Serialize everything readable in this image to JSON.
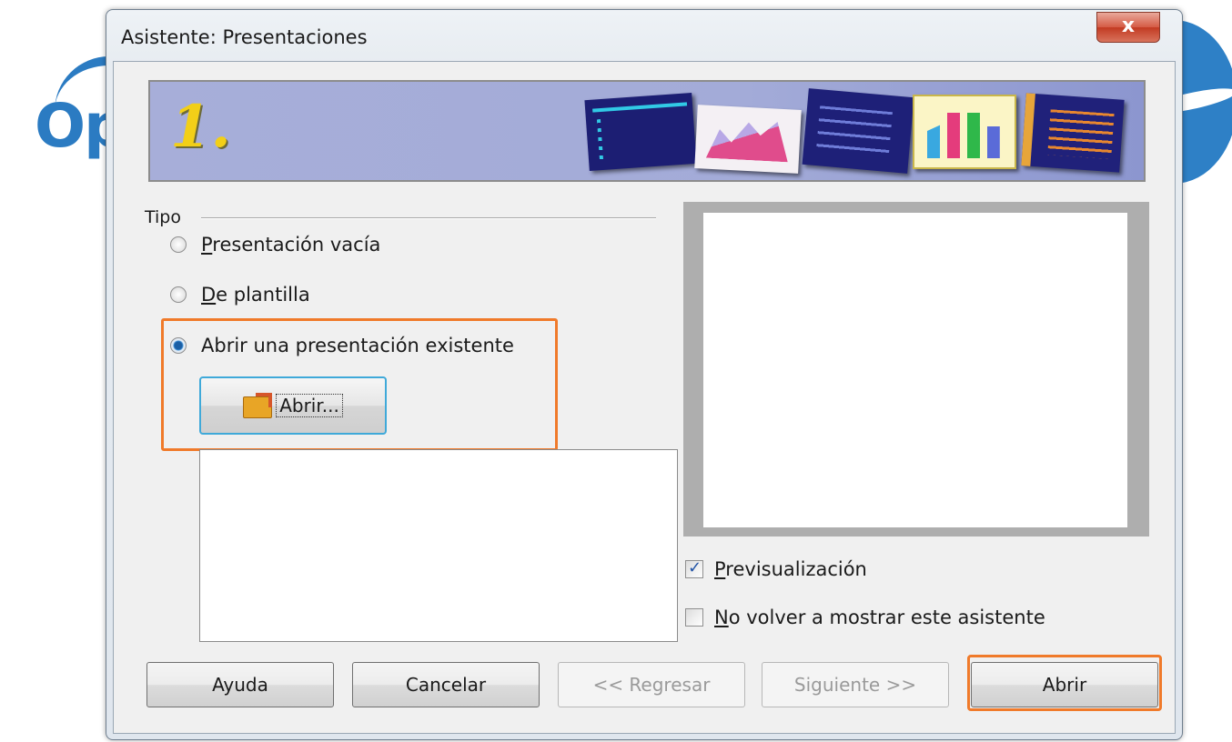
{
  "background": {
    "logo_text": "Op"
  },
  "window": {
    "title": "Asistente: Presentaciones",
    "close_label": "x"
  },
  "header": {
    "step_number": "1."
  },
  "type_group": {
    "label": "Tipo",
    "options": [
      {
        "label": "Presentación vacía",
        "checked": false
      },
      {
        "label": "De plantilla",
        "checked": false
      },
      {
        "label": "Abrir una presentación existente",
        "checked": true
      }
    ],
    "open_button_label": "Abrir..."
  },
  "options": {
    "preview_label": "Previsualización",
    "preview_checked": true,
    "dont_show_label": "No volver a mostrar este asistente",
    "dont_show_checked": false
  },
  "buttons": {
    "help": "Ayuda",
    "cancel": "Cancelar",
    "back": "<< Regresar",
    "next": "Siguiente >>",
    "open": "Abrir"
  },
  "colors": {
    "highlight": "#f07a2a",
    "banner": "#a7aed9",
    "logo_blue": "#2b7bc2"
  }
}
